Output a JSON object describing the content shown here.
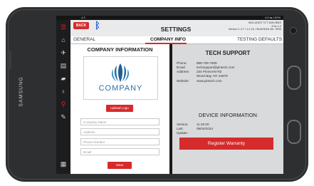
{
  "status": {
    "time": "4:3",
    "right": "4:3 ▾▴ 100%"
  },
  "header": {
    "back_label": "BACK",
    "title": "SETTINGS",
    "info_lines": [
      "INCLUDES 7CT 1650 BMS",
      "5.9v 1.2",
      "Version 1.4.7 / 1.4.16 / 9016/9016 Ver. 3003"
    ]
  },
  "tabs": [
    "GENERAL",
    "COMPANY INFO",
    "TESTING DEFAULTS"
  ],
  "company": {
    "section_title": "COMPANY INFORMATION",
    "logo_text": "COMPANY",
    "upload_label": "Upload Logo",
    "fields": [
      {
        "placeholder": "Company Name"
      },
      {
        "placeholder": "Address"
      },
      {
        "placeholder": "Phone Number"
      },
      {
        "placeholder": "Email"
      }
    ],
    "save_label": "Save"
  },
  "support": {
    "section_title": "TECH SUPPORT",
    "rows": [
      {
        "key": "Phone:",
        "value": "888-706-7809"
      },
      {
        "key": "Email:",
        "value": "techsupport@pintech.com"
      },
      {
        "key": "Address:",
        "value": "234 Pinecrest Rd"
      },
      {
        "key": "",
        "value": "Wood Bay, NY 34678"
      },
      {
        "key": "Website:",
        "value": "www.pintech.com"
      }
    ]
  },
  "device": {
    "section_title": "DEVICE INFORMATION",
    "rows": [
      {
        "key": "Version:",
        "value": "11.00.00"
      },
      {
        "key": "Last Update:",
        "value": "09/04/2024"
      }
    ],
    "register_label": "Register Warranty"
  },
  "brand": "SAMSUNG",
  "colors": {
    "accent": "#d52b2b",
    "bluetooth": "#2f64d6",
    "logo": "#2a72a8"
  }
}
